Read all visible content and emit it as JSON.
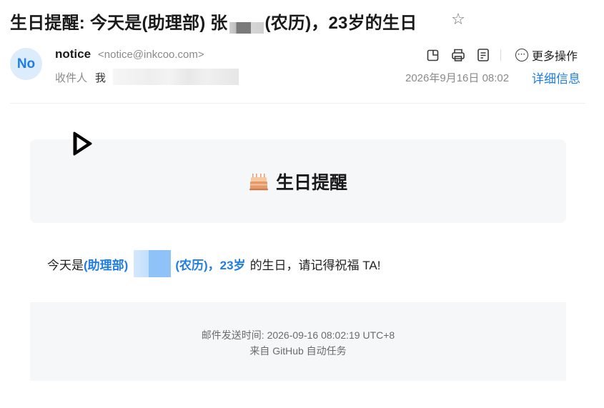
{
  "email": {
    "subject_prefix": "生日提醒: 今天是(助理部) 张",
    "subject_suffix": " (农历)，23岁的生日",
    "sender": {
      "avatar_initials": "No",
      "name": "notice",
      "email": "<notice@inkcoo.com>"
    },
    "recipients": {
      "label": "收件人",
      "me": "我",
      "redacted_char": "<"
    },
    "date": "2026年9月16日 08:02",
    "detail_link": "详细信息",
    "more_actions_label": "更多操作"
  },
  "content": {
    "card_title": "生日提醒",
    "msg_prefix": "今天是",
    "msg_dept": "(助理部)",
    "msg_calendar": "(农历)，23岁",
    "msg_suffix": "的生日，请记得祝福 TA!",
    "footer_sent_time": "邮件发送时间: 2026-09-16 08:02:19 UTC+8",
    "footer_source": "来自 GitHub 自动任务"
  },
  "colors": {
    "accent": "#1f7ee6",
    "muted_text": "#8a8a8a",
    "card_bg": "#f6f7f9",
    "avatar_bg": "#dcecfb"
  },
  "icons": {
    "star": "star-icon",
    "toolbar": [
      "open-in-window-icon",
      "print-icon",
      "note-icon"
    ],
    "more": "more-circle-icon",
    "card": "birthday-cake-icon",
    "cursor": "mouse-cursor-icon"
  }
}
